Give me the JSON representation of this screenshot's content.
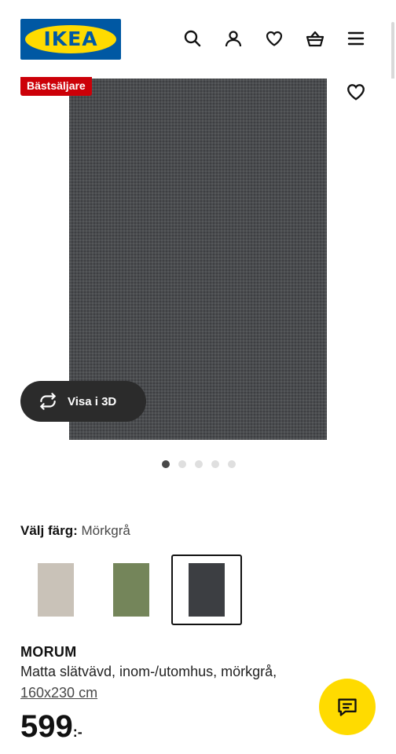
{
  "brand": {
    "logo_text": "IKEA",
    "blue": "#0058a3",
    "yellow": "#ffdb00"
  },
  "header": {
    "icons": [
      "search-icon",
      "user-icon",
      "heart-icon",
      "basket-icon",
      "menu-icon"
    ]
  },
  "gallery": {
    "badge": "Bästsäljare",
    "badge_color": "#cc0008",
    "view_3d_label": "Visa i 3D",
    "dots_total": 5,
    "dots_active": 1
  },
  "color_select": {
    "label": "Välj färg:",
    "value": "Mörkgrå",
    "swatches": [
      {
        "color": "#c9c2b8",
        "selected": false
      },
      {
        "color": "#74855a",
        "selected": false
      },
      {
        "color": "#3c3e42",
        "selected": true
      }
    ]
  },
  "product": {
    "name": "MORUM",
    "description": "Matta slätvävd, inom-/utomhus, mörkgrå,",
    "size": "160x230 cm",
    "price": "599",
    "price_suffix": ":-"
  }
}
